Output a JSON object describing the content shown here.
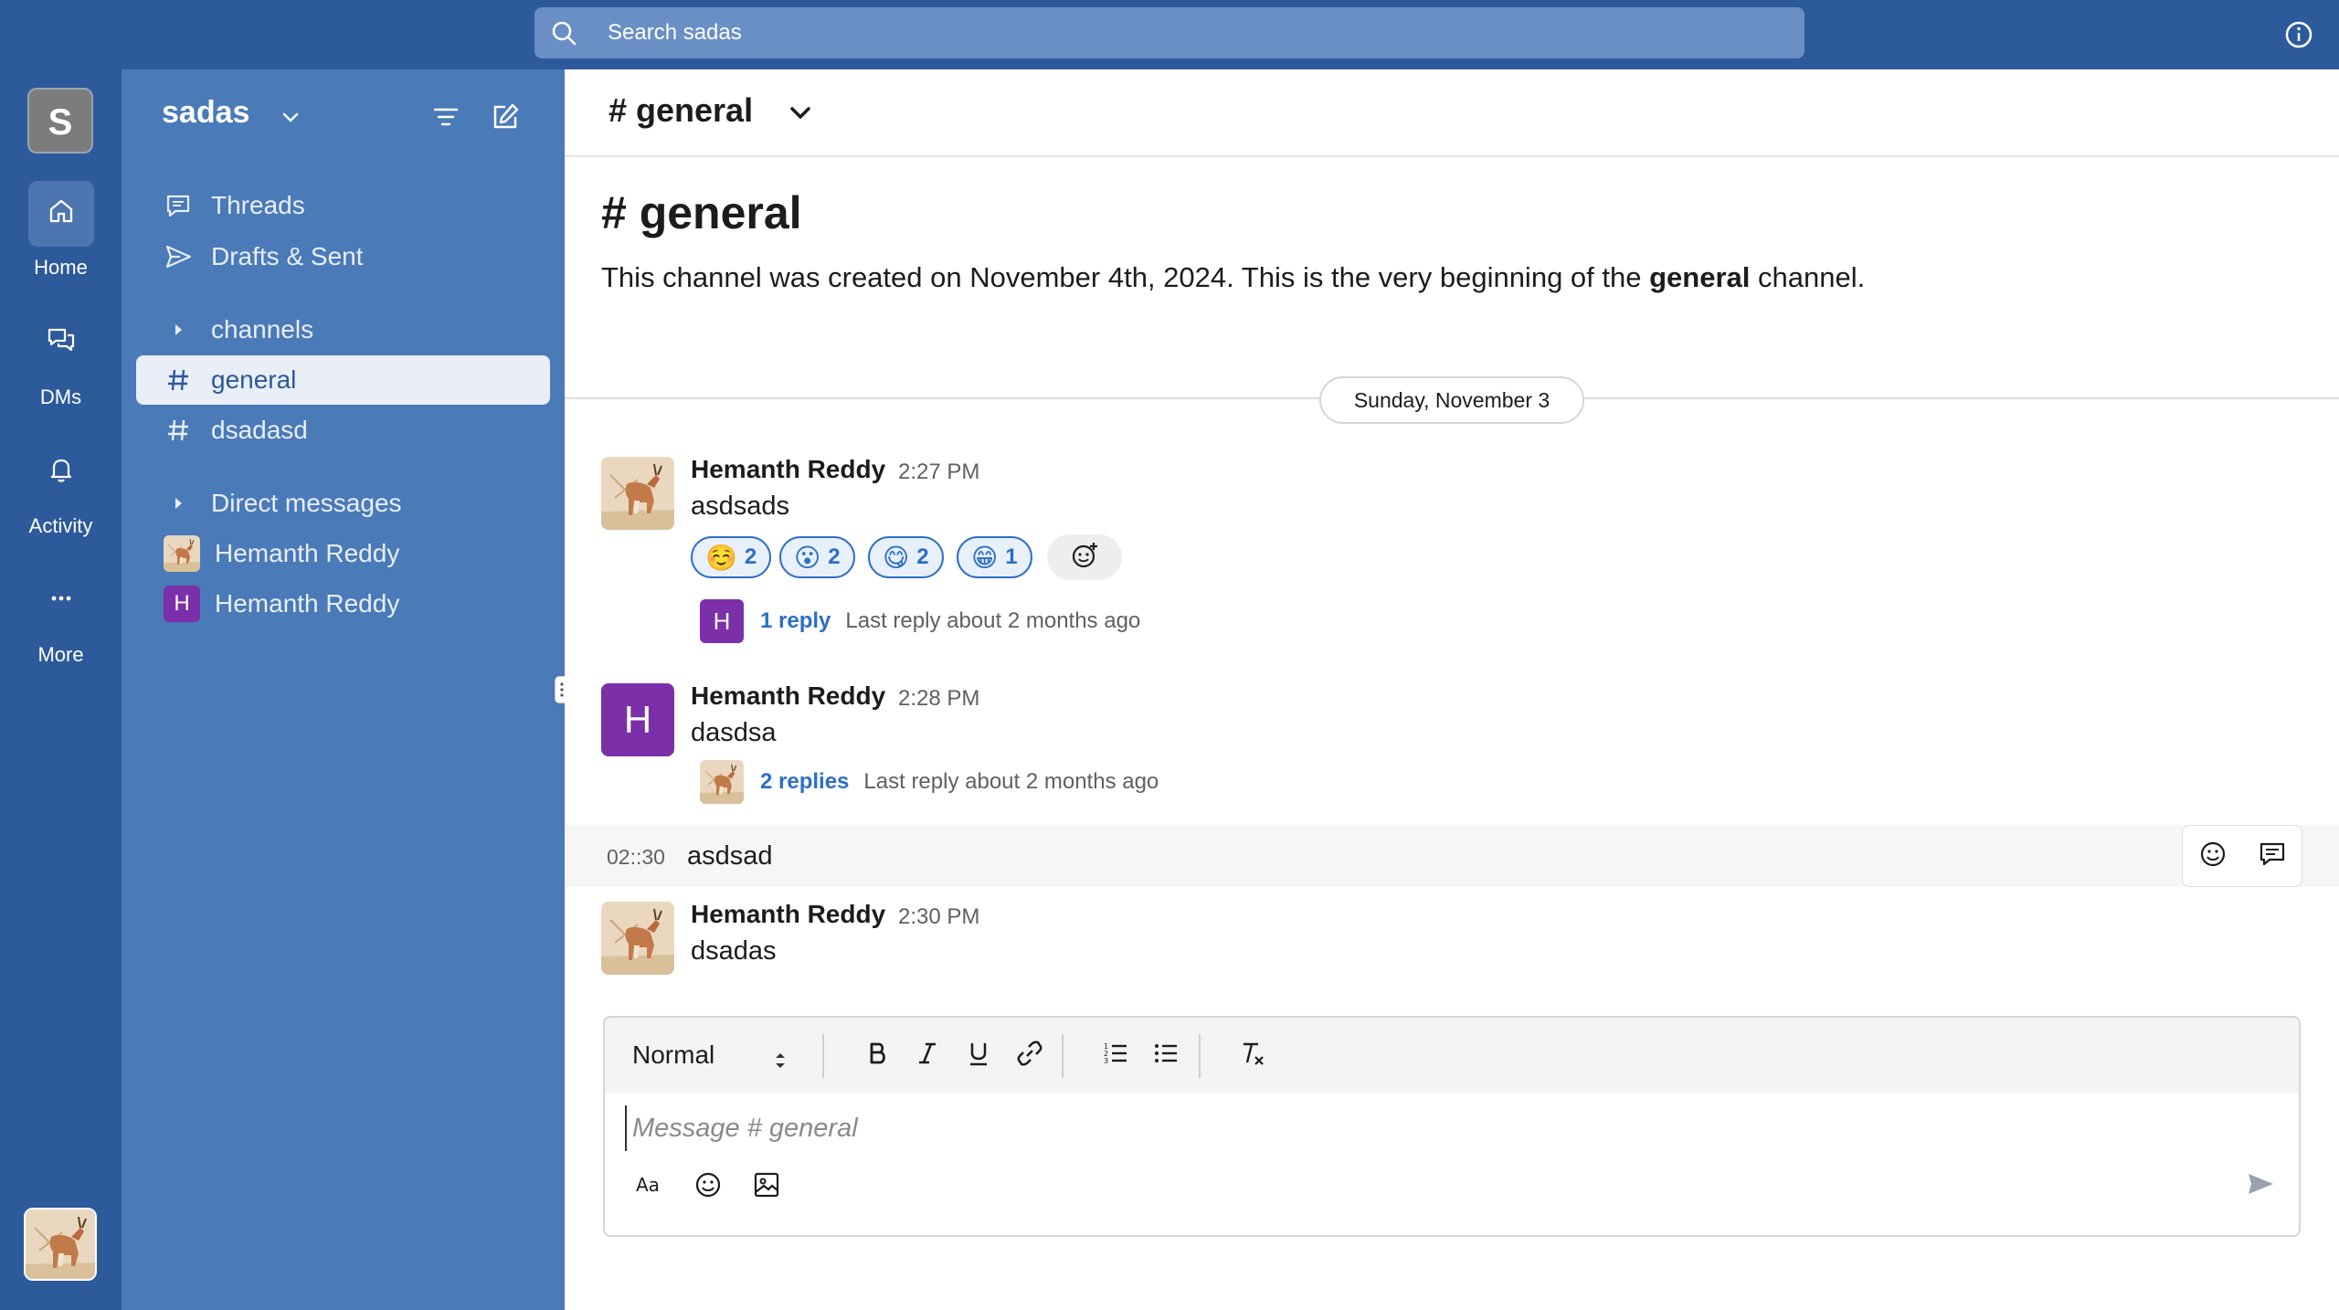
{
  "search": {
    "placeholder": "Search sadas"
  },
  "rail": {
    "workspace_initial": "S",
    "items": [
      {
        "label": "Home",
        "icon": "home-icon"
      },
      {
        "label": "DMs",
        "icon": "chat-bubbles-icon"
      },
      {
        "label": "Activity",
        "icon": "bell-icon"
      },
      {
        "label": "More",
        "icon": "ellipsis-icon"
      }
    ]
  },
  "sidebar": {
    "workspace_name": "sadas",
    "threads_label": "Threads",
    "drafts_label": "Drafts & Sent",
    "channels_section": "channels",
    "channels": [
      {
        "name": "general",
        "active": true
      },
      {
        "name": "dsadasd",
        "active": false
      }
    ],
    "dm_section": "Direct messages",
    "dms": [
      {
        "name": "Hemanth Reddy",
        "avatar": "photo"
      },
      {
        "name": "Hemanth Reddy",
        "avatar": "H"
      }
    ]
  },
  "channel": {
    "header_title": "# general",
    "intro_title": "# general",
    "intro_prefix": "This channel was created on November 4th, 2024. This is the very beginning of the ",
    "intro_bold": "general",
    "intro_suffix": " channel.",
    "date_divider": "Sunday, November 3"
  },
  "messages": [
    {
      "author": "Hemanth Reddy",
      "time": "2:27 PM",
      "text": "asdsads",
      "avatar": "photo",
      "reactions": [
        {
          "emoji": "☺️",
          "count": "2"
        },
        {
          "emoji": "😮",
          "count": "2"
        },
        {
          "emoji": "😋",
          "count": "2"
        },
        {
          "emoji": "😁",
          "count": "1"
        }
      ],
      "thread": {
        "avatar_initial": "H",
        "count_label": "1 reply",
        "last": "Last reply about 2 months ago"
      }
    },
    {
      "author": "Hemanth Reddy",
      "time": "2:28 PM",
      "text": "dasdsa",
      "avatar_initial": "H",
      "thread": {
        "count_label": "2 replies",
        "last": "Last reply about 2 months ago"
      }
    },
    {
      "continuation_time": "02::30",
      "text": "asdsad"
    },
    {
      "author": "Hemanth Reddy",
      "time": "2:30 PM",
      "text": "dsadas",
      "avatar": "photo"
    }
  ],
  "composer": {
    "format_value": "Normal",
    "placeholder": "Message # general"
  },
  "colors": {
    "rail_bg": "#2d5a9b",
    "sidebar_bg": "#4a7ab8",
    "accent": "#2d6fc7",
    "dm_avatar": "#7b2fa8"
  }
}
